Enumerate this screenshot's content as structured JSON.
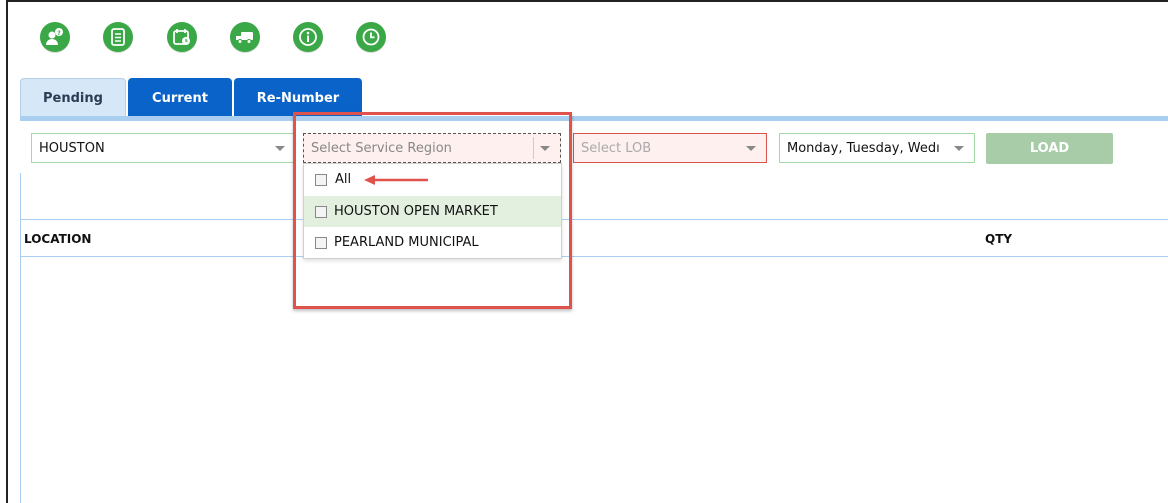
{
  "toolbar": {
    "icons": [
      "user-help-icon",
      "checklist-icon",
      "calendar-clock-icon",
      "delivery-truck-icon",
      "info-icon",
      "history-icon"
    ]
  },
  "tabs": [
    {
      "label": "Pending",
      "active": true
    },
    {
      "label": "Current",
      "active": false
    },
    {
      "label": "Re-Number",
      "active": false
    }
  ],
  "filters": {
    "location": "HOUSTON",
    "service_region_placeholder": "Select Service Region",
    "lob_placeholder": "Select LOB",
    "days": "Monday, Tuesday, Wedı",
    "load_label": "LOAD"
  },
  "region_options": [
    {
      "label": "All",
      "checked": false
    },
    {
      "label": "HOUSTON OPEN MARKET",
      "checked": false
    },
    {
      "label": "PEARLAND MUNICIPAL",
      "checked": false
    }
  ],
  "grid": {
    "columns": [
      "LOCATION",
      "QTY"
    ]
  },
  "colors": {
    "accent_green": "#3aa847",
    "tab_blue": "#0a63c9",
    "annotation_red": "#e0534c"
  }
}
